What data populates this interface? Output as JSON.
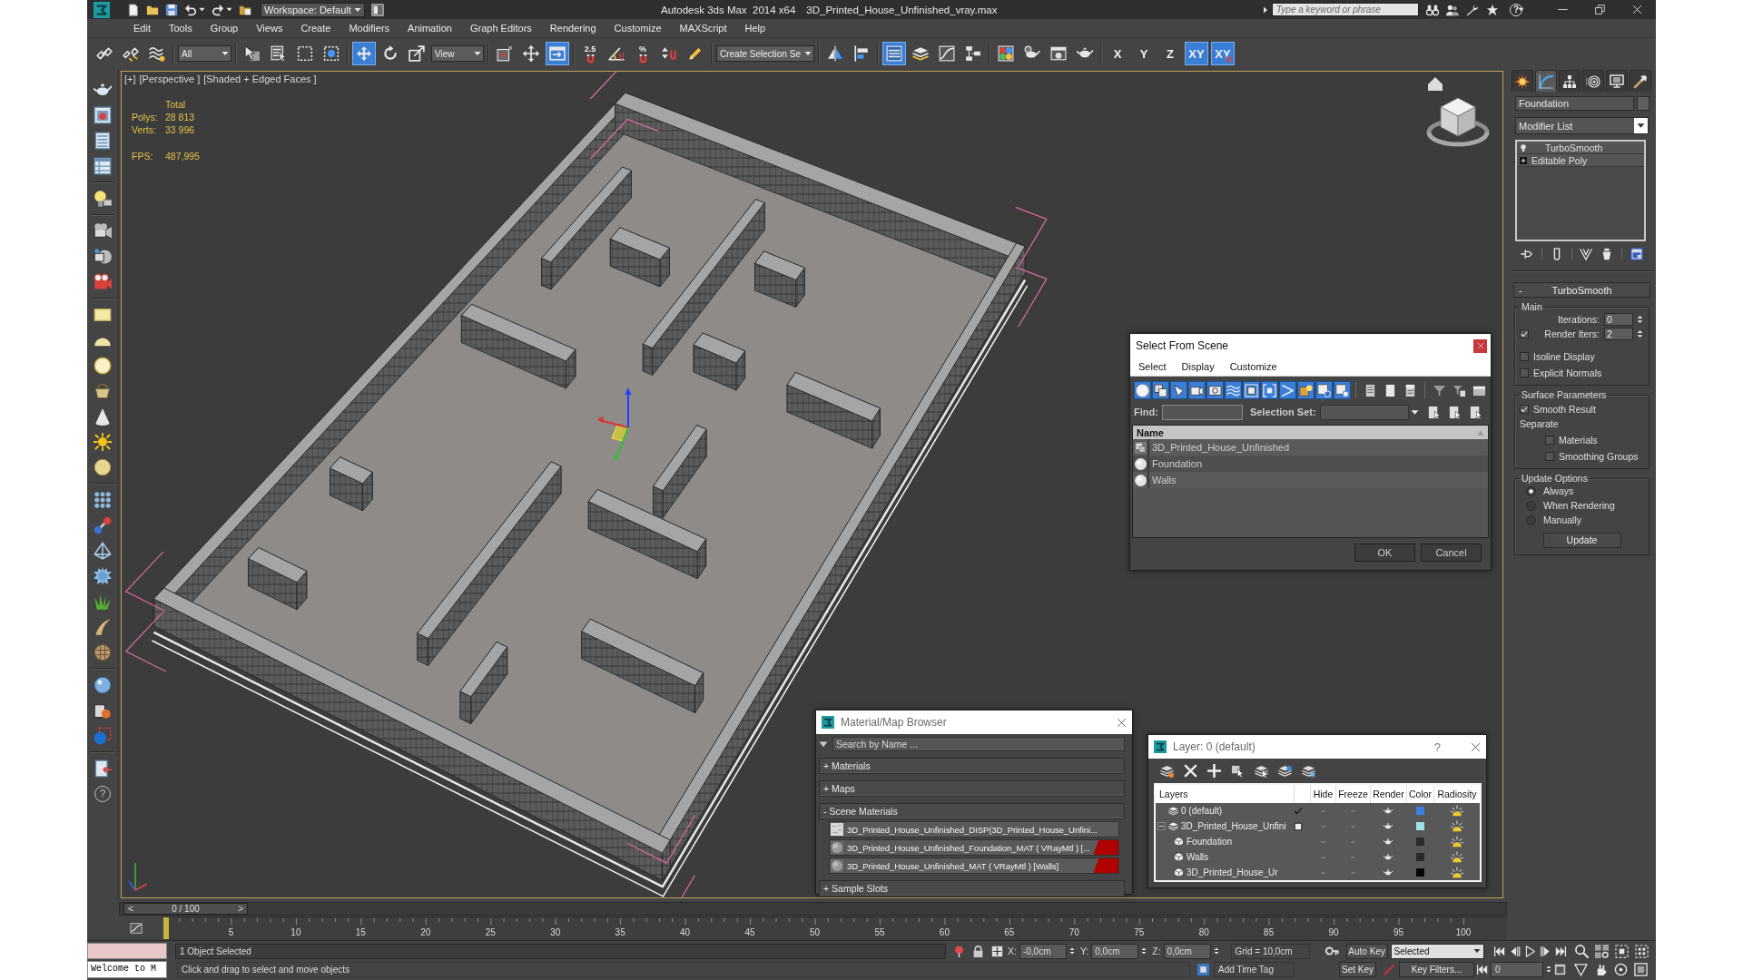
{
  "window": {
    "workspace": "Workspace: Default",
    "title": "Autodesk 3ds Max  2014 x64",
    "file": "3D_Printed_House_Unfinished_vray.max",
    "search": {
      "placeholder": "Type a keyword or phrase"
    },
    "help": "?"
  },
  "menu": [
    "Edit",
    "Tools",
    "Group",
    "Views",
    "Create",
    "Modifiers",
    "Animation",
    "Graph Editors",
    "Rendering",
    "Customize",
    "MAXScript",
    "Help"
  ],
  "main_toolbar": [
    {
      "kind": "icon",
      "active": false
    },
    {
      "kind": "icon",
      "active": false
    },
    {
      "kind": "icon",
      "active": false
    },
    {
      "kind": "dropdown",
      "value": "All"
    },
    {
      "kind": "icon",
      "active": false
    },
    {
      "kind": "icon",
      "active": false
    },
    {
      "kind": "icon",
      "active": false
    },
    {
      "kind": "icon",
      "active": false
    },
    {
      "kind": "icon",
      "active": true
    },
    {
      "kind": "icon",
      "active": false
    },
    {
      "kind": "icon",
      "active": false
    },
    {
      "kind": "dropdown",
      "value": "View"
    },
    {
      "kind": "icon",
      "active": false
    },
    {
      "kind": "icon",
      "active": false
    },
    {
      "kind": "icon",
      "active": true
    },
    {
      "kind": "icon",
      "active": false,
      "label": "2.5"
    },
    {
      "kind": "icon",
      "active": false
    },
    {
      "kind": "icon",
      "active": false,
      "label": "%"
    },
    {
      "kind": "icon",
      "active": false
    },
    {
      "kind": "icon",
      "active": false
    },
    {
      "kind": "dropdown",
      "value": "Create Selection Se"
    },
    {
      "kind": "icon",
      "active": false
    },
    {
      "kind": "icon",
      "active": false
    },
    {
      "kind": "icon",
      "active": true
    },
    {
      "kind": "icon",
      "active": false
    },
    {
      "kind": "icon",
      "active": false
    },
    {
      "kind": "icon",
      "active": false
    },
    {
      "kind": "icon",
      "active": false
    },
    {
      "kind": "icon",
      "active": false
    },
    {
      "kind": "icon",
      "active": false
    },
    {
      "kind": "icon",
      "active": false
    },
    {
      "kind": "axis",
      "label": "X",
      "active": false
    },
    {
      "kind": "axis",
      "label": "Y",
      "active": false
    },
    {
      "kind": "axis",
      "label": "Z",
      "active": false
    },
    {
      "kind": "axis",
      "label": "XY",
      "active": true
    },
    {
      "kind": "axis",
      "label": "XY",
      "active": true
    }
  ],
  "left_toolbar": {
    "help": "?"
  },
  "viewport": {
    "labels": [
      "[+]",
      "[Perspective ]",
      "[Shaded + Edged Faces ]"
    ],
    "stats_header": "Total",
    "stats": [
      {
        "label": "Polys:",
        "value": "28 813"
      },
      {
        "label": "Verts:",
        "value": "33 996"
      }
    ],
    "fps": {
      "label": "FPS:",
      "value": "487,995"
    }
  },
  "command_panel": {
    "tabs": [
      {
        "selected": false
      },
      {
        "selected": true
      },
      {
        "selected": false
      },
      {
        "selected": false
      },
      {
        "selected": false
      },
      {
        "selected": false
      }
    ],
    "object_name": "Foundation",
    "modifier_list": "Modifier List",
    "stack": [
      {
        "kind": "modifier",
        "label": "TurboSmooth"
      },
      {
        "kind": "base",
        "label": "Editable Poly"
      }
    ],
    "rollout": {
      "sign": "-",
      "title": "TurboSmooth",
      "groups": [
        {
          "title": "Main",
          "controls": [
            {
              "kind": "spinner",
              "label": "Iterations:",
              "value": "0"
            },
            {
              "kind": "check_spinner",
              "label": "Render Iters:",
              "checked": true,
              "value": "2"
            },
            {
              "kind": "checkbox",
              "label": "Isoline Display",
              "checked": false
            },
            {
              "kind": "checkbox",
              "label": "Explicit Normals",
              "checked": false
            }
          ]
        },
        {
          "title": "Surface Parameters",
          "controls": [
            {
              "kind": "checkbox",
              "label": "Smooth Result",
              "checked": true
            },
            {
              "kind": "label",
              "label": "Separate",
              "children": [
                {
                  "kind": "checkbox",
                  "label": "Materials",
                  "checked": false
                },
                {
                  "kind": "checkbox",
                  "label": "Smoothing Groups",
                  "checked": false
                }
              ]
            }
          ]
        },
        {
          "title": "Update Options",
          "controls": [
            {
              "kind": "radio",
              "label": "Always",
              "selected": true
            },
            {
              "kind": "radio",
              "label": "When Rendering",
              "selected": false
            },
            {
              "kind": "radio",
              "label": "Manually",
              "selected": false
            },
            {
              "kind": "button",
              "label": "Update"
            }
          ]
        }
      ]
    }
  },
  "select_from_scene": {
    "title": "Select From Scene",
    "menu": [
      "Select",
      "Display",
      "Customize"
    ],
    "filters": [
      {
        "on": true
      },
      {
        "on": true
      },
      {
        "on": true
      },
      {
        "on": true
      },
      {
        "on": true
      },
      {
        "on": true
      },
      {
        "on": true
      },
      {
        "on": true
      },
      {
        "on": true
      },
      {
        "on": true
      },
      {
        "on": true
      },
      {
        "on": true
      }
    ],
    "find_label": "Find:",
    "selection_set_label": "Selection Set:",
    "column": "Name",
    "rows": [
      {
        "kind": "group",
        "name": "3D_Printed_House_Unfinished"
      },
      {
        "kind": "object",
        "name": "Foundation"
      },
      {
        "kind": "object",
        "name": "Walls"
      }
    ],
    "buttons": [
      "OK",
      "Cancel"
    ]
  },
  "material_browser": {
    "title": "Material/Map Browser",
    "search": {
      "placeholder": "Search by Name ..."
    },
    "groups": [
      {
        "sign": "+",
        "label": "Materials"
      },
      {
        "sign": "+",
        "label": "Maps"
      },
      {
        "sign": "-",
        "label": "Scene Materials",
        "items": [
          {
            "kind": "map",
            "label": "3D_Printed_House_Unfinished_DISP(3D_Printed_House_Unfini...",
            "flagged": false
          },
          {
            "kind": "material",
            "label": "3D_Printed_House_Unfinished_Foundation_MAT ( VRayMtl ) [...",
            "flagged": true
          },
          {
            "kind": "material",
            "label": "3D_Printed_House_Unfinished_MAT ( VRayMtl ) [Walls]",
            "flagged": true
          }
        ]
      },
      {
        "sign": "+",
        "label": "Sample Slots"
      }
    ]
  },
  "layer_dialog": {
    "title": "Layer: 0 (default)",
    "help": "?",
    "columns": [
      "Layers",
      "Hide",
      "Freeze",
      "Render",
      "Color",
      "Radiosity"
    ],
    "rows": [
      {
        "kind": "layer",
        "name": "0 (default)",
        "current": true,
        "hidden": false,
        "frozen": false,
        "color": "#3b7fe3"
      },
      {
        "kind": "layer",
        "name": "3D_Printed_House_Unfini",
        "current": false,
        "expanded": true,
        "hidden": false,
        "frozen": false,
        "color": "#9fe3ea",
        "children": [
          {
            "kind": "object",
            "name": "Foundation",
            "hidden": false,
            "frozen": false,
            "color": "#2a2a2a"
          },
          {
            "kind": "object",
            "name": "Walls",
            "hidden": false,
            "frozen": false,
            "color": "#2a2a2a"
          },
          {
            "kind": "object",
            "name": "3D_Printed_House_Ur",
            "hidden": false,
            "frozen": false,
            "color": "#050505"
          }
        ]
      }
    ]
  },
  "time_slider": {
    "previous": "<",
    "position": "0 / 100",
    "next": ">"
  },
  "trackbar": {
    "labels": [
      "5",
      "10",
      "15",
      "20",
      "25",
      "30",
      "35",
      "40",
      "45",
      "50",
      "55",
      "60",
      "65",
      "70",
      "75",
      "80",
      "85",
      "90",
      "95",
      "100"
    ]
  },
  "status_bar": {
    "listener": "Welcome to M",
    "selection": "1 Object Selected",
    "prompt": "Click and drag to select and move objects",
    "coordinates": [
      {
        "label": "X:",
        "value": "-0,0cm"
      },
      {
        "label": "Y:",
        "value": "0,0cm"
      },
      {
        "label": "Z:",
        "value": "0,0cm"
      }
    ],
    "grid": "Grid = 10,0cm",
    "add_time_tag": "Add Time Tag",
    "auto_key": "Auto Key",
    "key_mode": "Selected",
    "set_key": "Set Key",
    "key_filters": "Key Filters...",
    "frame": "0"
  }
}
